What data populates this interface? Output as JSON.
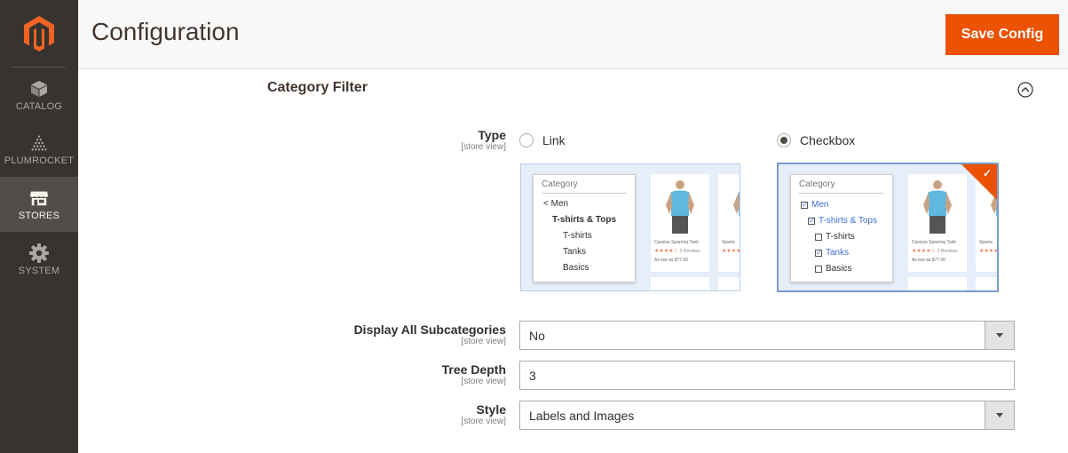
{
  "sidebar": {
    "items": [
      {
        "label": "CATALOG",
        "icon": "cube-icon"
      },
      {
        "label": "PLUMROCKET",
        "icon": "pyramid-icon"
      },
      {
        "label": "STORES",
        "icon": "store-icon",
        "active": true
      },
      {
        "label": "SYSTEM",
        "icon": "gear-icon"
      }
    ]
  },
  "header": {
    "title": "Configuration",
    "save_label": "Save Config"
  },
  "section": {
    "title": "Category Filter"
  },
  "fields": {
    "type": {
      "label": "Type",
      "scope": "[store view]",
      "options": [
        {
          "label": "Link",
          "selected": false
        },
        {
          "label": "Checkbox",
          "selected": true
        }
      ]
    },
    "display_all_subcategories": {
      "label": "Display All Subcategories",
      "scope": "[store view]",
      "value": "No"
    },
    "tree_depth": {
      "label": "Tree Depth",
      "scope": "[store view]",
      "value": "3"
    },
    "style": {
      "label": "Style",
      "scope": "[store view]",
      "value": "Labels and Images"
    }
  },
  "preview_link": {
    "panel_title": "Category",
    "items": [
      "< Men",
      "T-shirts & Tops",
      "T-shirts",
      "Tanks",
      "Basics"
    ],
    "product_name": "Cassius Sparring Tank",
    "product_name_2": "Sparta",
    "reviews": "2 Reviews",
    "price": "As low as $77.00"
  },
  "preview_checkbox": {
    "panel_title": "Category",
    "items": [
      "Men",
      "T-shirts & Tops",
      "T-shirts",
      "Tanks",
      "Basics"
    ],
    "product_name": "Cassius Sparring Tank",
    "product_name_2": "Sparta",
    "reviews": "2 Reviews",
    "price": "As low as $77.00"
  },
  "colors": {
    "accent": "#eb5202",
    "sidebar": "#373330",
    "link": "#3d6fd9"
  }
}
